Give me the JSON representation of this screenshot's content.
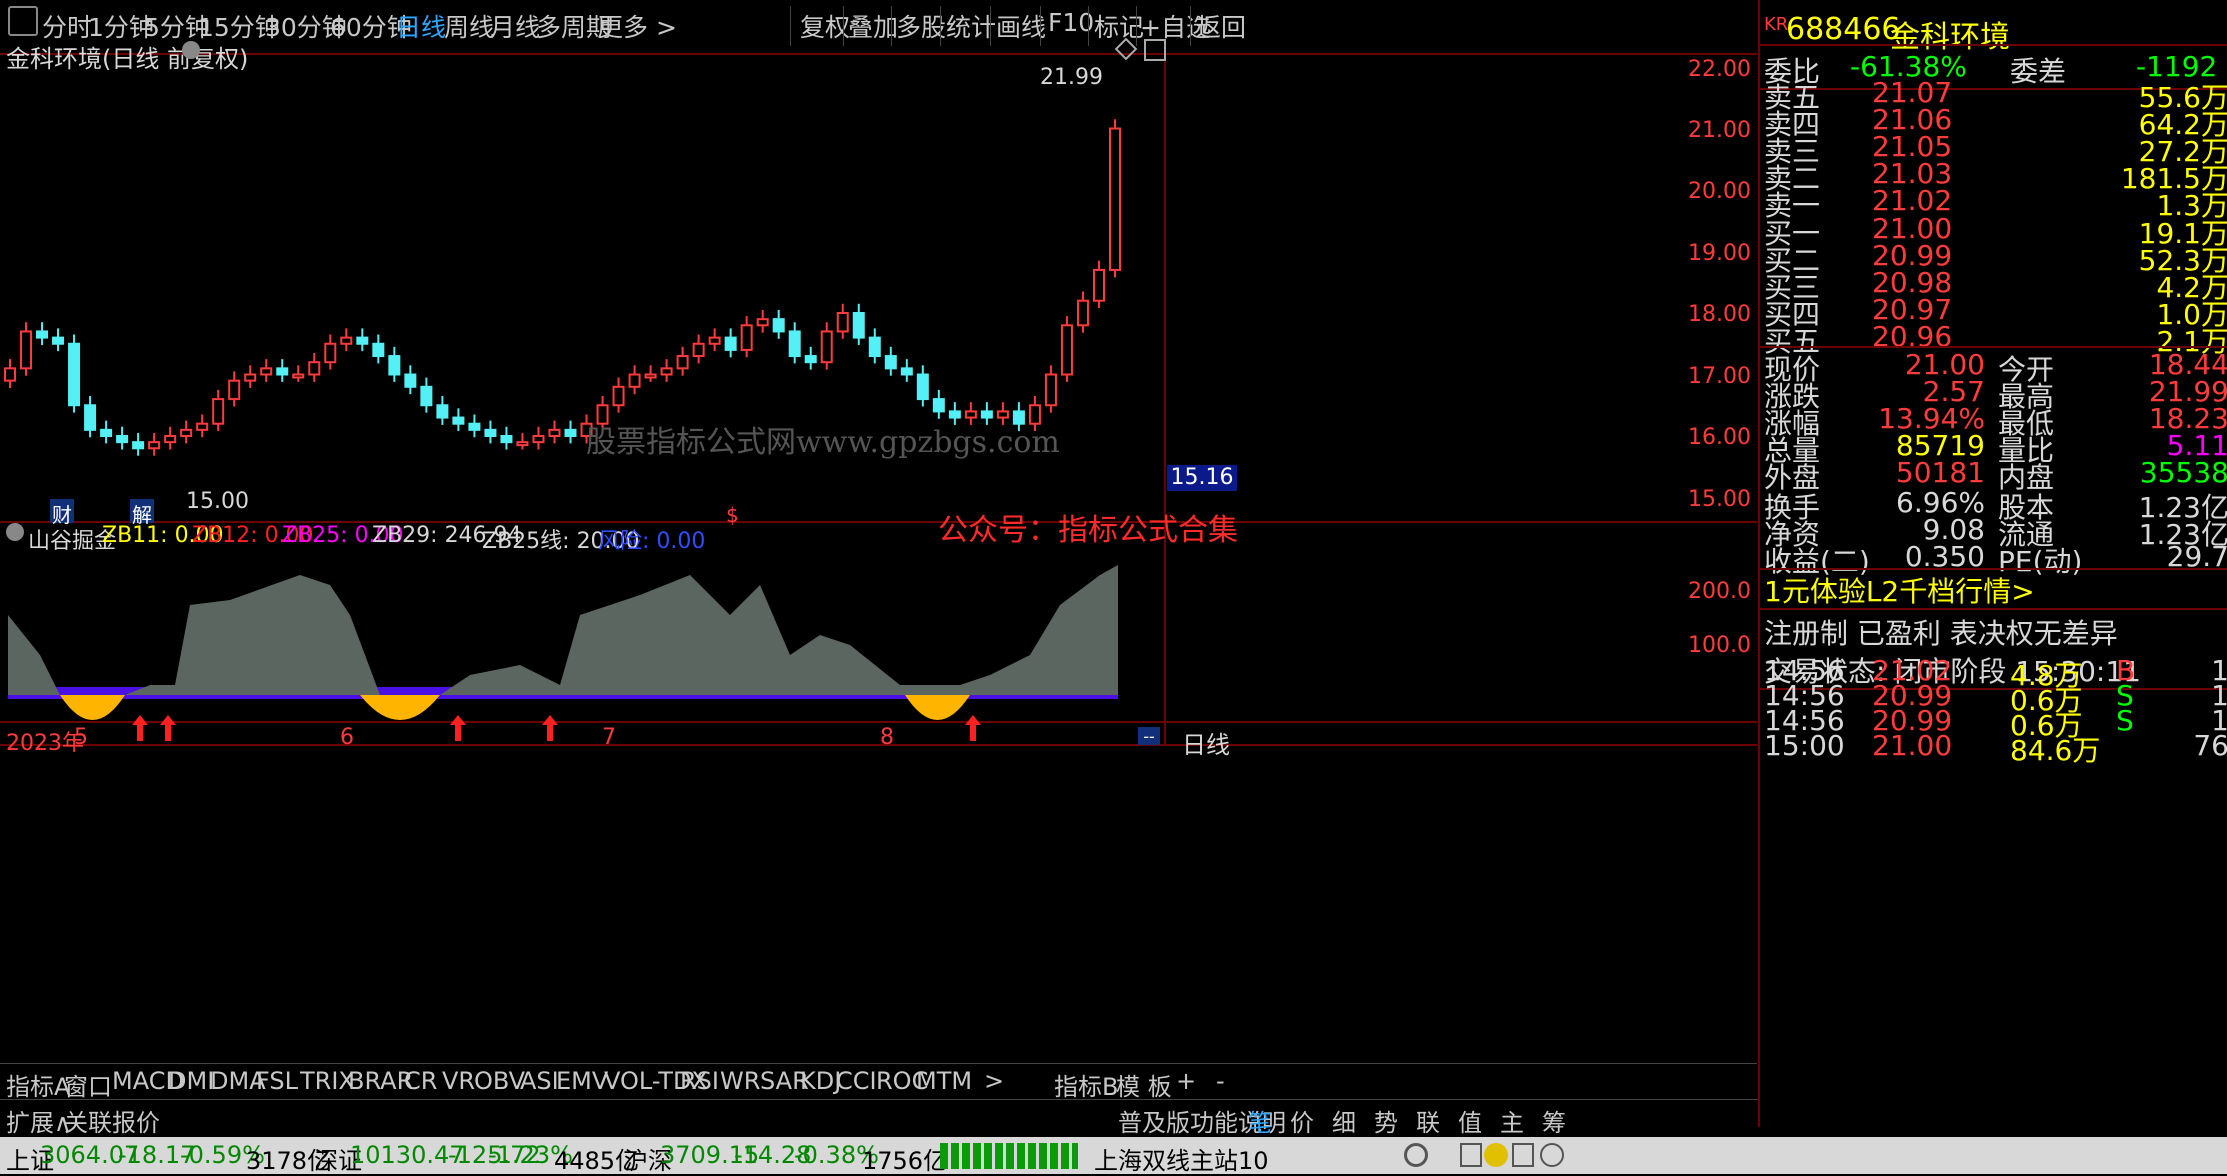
{
  "toolbar": {
    "periods": [
      "分时",
      "1分钟",
      "5分钟",
      "15分钟",
      "30分钟",
      "60分钟",
      "日线",
      "周线",
      "月线",
      "多周期",
      "更多 >"
    ],
    "active_period": "日线",
    "tools": [
      "复权",
      "叠加",
      "多股",
      "统计",
      "画线",
      "F10",
      "标记",
      "+自选",
      "返回"
    ]
  },
  "chart_title": "金科环境(日线 前复权)",
  "price_axis": [
    "22.00",
    "21.00",
    "20.00",
    "19.00",
    "18.00",
    "17.00",
    "16.00",
    "15.00"
  ],
  "current_price_tag": "15.16",
  "high_annotation": "21.99",
  "low_annotation": "15.00",
  "markers": {
    "cai": "财",
    "jie": "解",
    "dollar": "$"
  },
  "watermark": "股票指标公式网www.gpzbgs.com",
  "overlay_text": "公众号：指标公式合集",
  "indicator": {
    "name": "山谷掘金",
    "zb11": "ZB11: 0.00",
    "zb12": "ZB12: 0.00",
    "zb25": "ZB25: 0.00",
    "zb29": "ZB29: 246.94",
    "zb25line": "ZB25线: 20.00",
    "risk": "风险: 0.00",
    "axis": [
      "200.0",
      "100.0"
    ]
  },
  "time_axis": {
    "year": "2023年",
    "months": [
      "5",
      "6",
      "7",
      "8"
    ]
  },
  "period_label": "日线",
  "indicator_tabs": [
    "指标A",
    "窗口",
    "MACD",
    "DMI",
    "DMA",
    "FSL",
    "TRIX",
    "BRAR",
    "CR",
    "VR",
    "OBV",
    "ASI",
    "EMV",
    "VOL-TDX",
    "RSI",
    "WR",
    "SAR",
    "KDJ",
    "CCI",
    "ROC",
    "MTM",
    ">"
  ],
  "indicator_b": "指标B",
  "mode_tabs": [
    "模 板",
    "+",
    "-"
  ],
  "bottom_left_tabs": [
    "扩展∧",
    "关联报价"
  ],
  "bottom_right_link": "普及版功能说明",
  "bottom_right_tabs": [
    "笔",
    "价",
    "细",
    "势",
    "联",
    "值",
    "主",
    "筹"
  ],
  "quote": {
    "tag": "KR",
    "code": "688466",
    "name": "金科环境",
    "weibi_label": "委比",
    "weibi": "-61.38%",
    "weicha_label": "委差",
    "weicha": "-1192",
    "sells": [
      {
        "label": "卖五",
        "price": "21.07",
        "vol": "55.6万"
      },
      {
        "label": "卖四",
        "price": "21.06",
        "vol": "64.2万"
      },
      {
        "label": "卖三",
        "price": "21.05",
        "vol": "27.2万"
      },
      {
        "label": "卖二",
        "price": "21.03",
        "vol": "181.5万"
      },
      {
        "label": "卖一",
        "price": "21.02",
        "vol": "1.3万"
      }
    ],
    "buys": [
      {
        "label": "买一",
        "price": "21.00",
        "vol": "19.1万"
      },
      {
        "label": "买二",
        "price": "20.99",
        "vol": "52.3万"
      },
      {
        "label": "买三",
        "price": "20.98",
        "vol": "4.2万"
      },
      {
        "label": "买四",
        "price": "20.97",
        "vol": "1.0万"
      },
      {
        "label": "买五",
        "price": "20.96",
        "vol": "2.1万"
      }
    ],
    "stats": [
      {
        "l1": "现价",
        "v1": "21.00",
        "l2": "今开",
        "v2": "18.44"
      },
      {
        "l1": "涨跌",
        "v1": "2.57",
        "l2": "最高",
        "v2": "21.99"
      },
      {
        "l1": "涨幅",
        "v1": "13.94%",
        "l2": "最低",
        "v2": "18.23"
      },
      {
        "l1": "总量",
        "v1": "85719",
        "l2": "量比",
        "v2": "5.11"
      },
      {
        "l1": "外盘",
        "v1": "50181",
        "l2": "内盘",
        "v2": "35538"
      }
    ],
    "stats2": [
      {
        "l1": "换手",
        "v1": "6.96%",
        "l2": "股本",
        "v2": "1.23亿"
      },
      {
        "l1": "净资",
        "v1": "9.08",
        "l2": "流通",
        "v2": "1.23亿"
      },
      {
        "l1": "收益(二)",
        "v1": "0.350",
        "l2": "PE(动)",
        "v2": "29.7"
      }
    ],
    "promo": "1元体验L2千档行情>",
    "tags_line": "注册制 已盈利 表决权无差异",
    "trade_status": "交易状态: 闭市阶段 15:30:11",
    "ticks": [
      {
        "time": "14:56",
        "price": "21.02",
        "vol": "4.8万",
        "side": "B",
        "n": "1"
      },
      {
        "time": "14:56",
        "price": "20.99",
        "vol": "0.6万",
        "side": "S",
        "n": "1"
      },
      {
        "time": "14:56",
        "price": "20.99",
        "vol": "0.6万",
        "side": "S",
        "n": "1"
      },
      {
        "time": "15:00",
        "price": "21.00",
        "vol": "84.6万",
        "side": "",
        "n": "76"
      }
    ]
  },
  "status_bar": {
    "sh_label": "上证",
    "sh": "3064.07",
    "sh_chg": "-18.17",
    "sh_pct": "-0.59%",
    "sh_amt": "3178亿",
    "sz_label": "深证",
    "sz": "10130.47",
    "sz_chg": "-125.72",
    "sz_pct": "-1.23%",
    "sz_amt": "4485亿",
    "hs_label": "沪深",
    "hs": "3709.15",
    "hs_chg": "-14.28",
    "hs_pct": "-0.38%",
    "hs_amt": "1756亿",
    "server": "上海双线主站10"
  },
  "colors": {
    "up": "#ff3b3b",
    "down": "#53f0f5",
    "bg": "#000000",
    "border": "#6b0000",
    "area": "#5c6660",
    "band": "#4b10e6",
    "valley": "#ffb400"
  }
}
